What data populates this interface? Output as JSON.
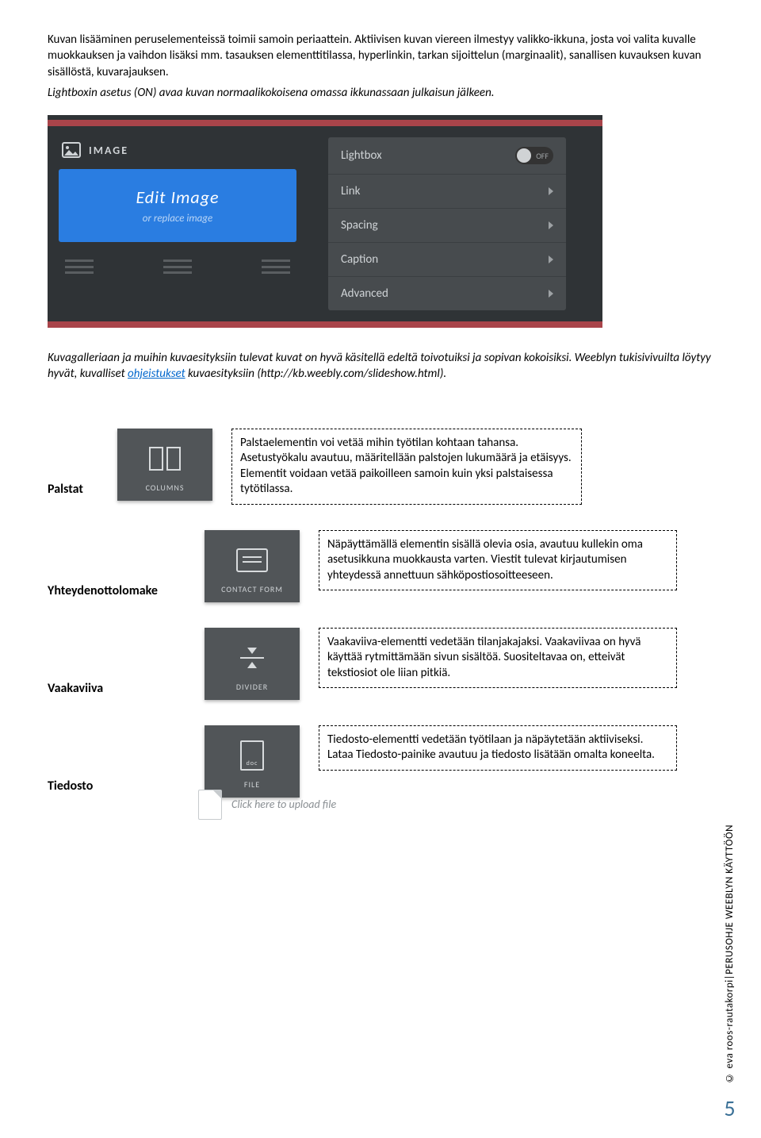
{
  "paragraphs": {
    "p1": "Kuvan lisääminen peruselementeissä toimii samoin periaattein. Aktiivisen kuvan viereen ilmestyy valikko-ikkuna, josta voi valita kuvalle muokkauksen ja vaihdon lisäksi mm. tasauksen elementtitilassa, hyperlinkin, tarkan sijoittelun (marginaalit), sanallisen kuvauksen kuvan sisällöstä, kuvarajauksen.",
    "p2": "Lightboxin asetus (ON) avaa kuvan normaalikokoisena omassa ikkunassaan julkaisun jälkeen.",
    "p3a": "Kuvagalleriaan ja muihin kuvaesityksiin tulevat kuvat on hyvä käsitellä edeltä toivotuiksi ja sopivan kokoisiksi. Weeblyn tukisivivuilta löytyy hyvät, kuvalliset ",
    "p3link": "ohjeistukset",
    "p3b": " kuvaesityksiin (http://kb.weebly.com/slideshow.html)."
  },
  "shot1": {
    "title": "IMAGE",
    "edit": "Edit Image",
    "replace": "or replace image",
    "settings": {
      "lightbox": "Lightbox",
      "lightbox_state": "OFF",
      "link": "Link",
      "spacing": "Spacing",
      "caption": "Caption",
      "advanced": "Advanced"
    }
  },
  "rows": {
    "columns": {
      "heading": "Palstat",
      "tile": "COLUMNS",
      "note": "Palstaelementin voi vetää mihin työtilan kohtaan tahansa. Asetustyökalu avautuu, määritellään palstojen lukumäärä ja etäisyys. Elementit voidaan vetää paikoilleen samoin kuin yksi palstaisessa tytötilassa."
    },
    "contact": {
      "heading": "Yhteydenottolomake",
      "tile": "CONTACT FORM",
      "note": "Näpäyttämällä elementin sisällä olevia osia, avautuu kullekin oma asetusikkuna muokkausta varten. Viestit tulevat kirjautumisen yhteydessä annettuun sähköpostiosoitteeseen."
    },
    "divider": {
      "heading": "Vaakaviiva",
      "tile": "DIVIDER",
      "note": "Vaakaviiva-elementti vedetään tilanjakajaksi. Vaakaviivaa on hyvä käyttää rytmittämään sivun sisältöä. Suositeltavaa on, etteivät tekstiosiot ole liian pitkiä."
    },
    "file": {
      "heading": "Tiedosto",
      "tile": "FILE",
      "note": "Tiedosto-elementti  vedetään  työtilaan ja näpäytetään aktiiviseksi. Lataa Tiedosto-painike avautuu ja tiedosto lisätään omalta koneelta."
    }
  },
  "upload_hint": "Click here to upload file",
  "footer": {
    "author": "© eva roos-rautakorpi",
    "title": "PERUSOHJE  WEEBLYN KÄYTTÖÖN",
    "page": "5"
  }
}
